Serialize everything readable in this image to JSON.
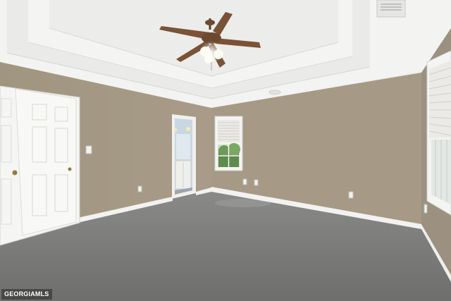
{
  "photo": {
    "subject": "empty-bedroom",
    "watermark_text": "GEORGIAMLS",
    "colors": {
      "ceiling": "#f2f2f0",
      "wall": "#a59a88",
      "wall_right": "#9c9180",
      "trim": "#f4f4f2",
      "carpet": "#7a7a78",
      "door": "#f6f6f4",
      "fan_blade": "#7a5236",
      "window_glass": "#e8ece8"
    }
  }
}
